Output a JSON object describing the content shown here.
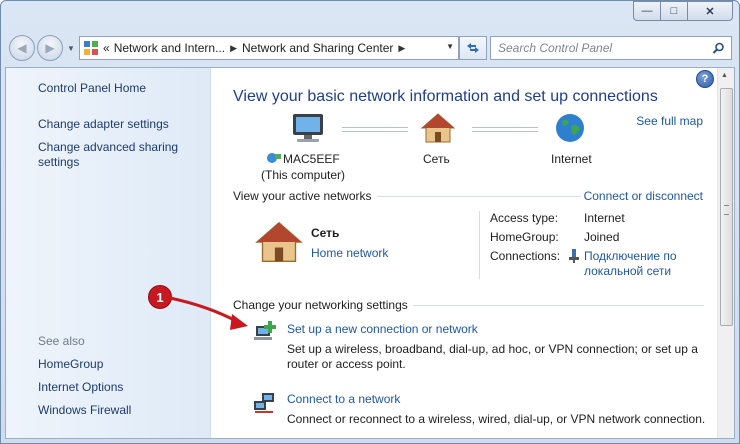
{
  "addressbar": {
    "crumbs": [
      "Network and Intern...",
      "Network and Sharing Center"
    ],
    "overflow": "«"
  },
  "search": {
    "placeholder": "Search Control Panel"
  },
  "sidebar": {
    "links": [
      "Control Panel Home",
      "Change adapter settings",
      "Change advanced sharing settings"
    ],
    "see_also": "See also",
    "see_also_links": [
      "HomeGroup",
      "Internet Options",
      "Windows Firewall"
    ]
  },
  "main": {
    "heading": "View your basic network information and set up connections",
    "see_full_map": "See full map",
    "map": {
      "computer_name": "MAC5EEF",
      "computer_sub": "(This computer)",
      "network": "Сеть",
      "internet": "Internet"
    },
    "active_networks": {
      "title": "View your active networks",
      "connect_link": "Connect or disconnect",
      "network_name": "Сеть",
      "network_type": "Home network",
      "access_type_label": "Access type:",
      "access_type_value": "Internet",
      "homegroup_label": "HomeGroup:",
      "homegroup_value": "Joined",
      "connections_label": "Connections:",
      "connections_value_line1": "Подключение по",
      "connections_value_line2": "локальной сети"
    },
    "change_settings": {
      "title": "Change your networking settings",
      "tasks": [
        {
          "title": "Set up a new connection or network",
          "desc": "Set up a wireless, broadband, dial-up, ad hoc, or VPN connection; or set up a router or access point."
        },
        {
          "title": "Connect to a network",
          "desc": "Connect or reconnect to a wireless, wired, dial-up, or VPN network connection."
        }
      ]
    }
  },
  "annotation": {
    "badge": "1"
  },
  "colors": {
    "link": "#1f57a8",
    "heading": "#1e3f8c",
    "badge": "#c7191f"
  }
}
